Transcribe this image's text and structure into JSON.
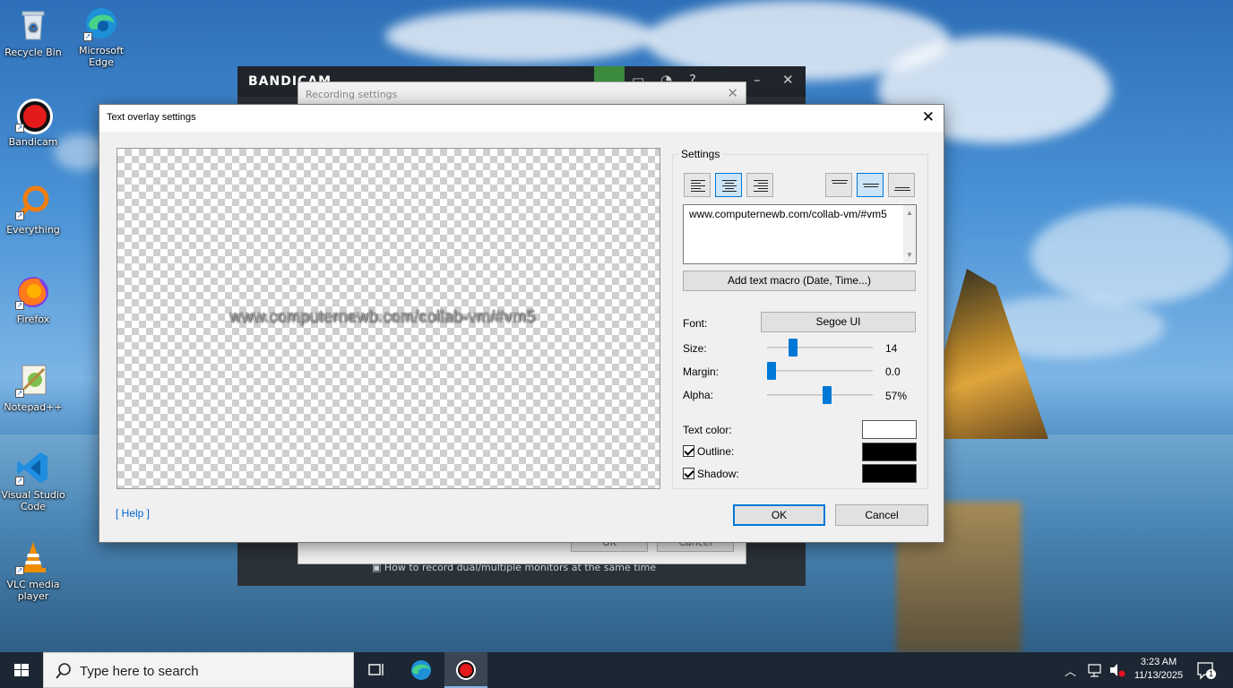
{
  "desktop": {
    "icons": [
      {
        "label": "Recycle Bin"
      },
      {
        "label": "Microsoft Edge"
      },
      {
        "label": "Bandicam"
      },
      {
        "label": "Everything"
      },
      {
        "label": "Firefox"
      },
      {
        "label": "Notepad++"
      },
      {
        "label": "Visual Studio Code"
      },
      {
        "label": "VLC media player"
      }
    ]
  },
  "bandicam_window": {
    "logo": "BANDICAM",
    "footer_tip": "How to record dual/multiple monitors at the same time"
  },
  "recording_settings": {
    "title": "Recording settings",
    "ok_label": "OK",
    "cancel_label": "Cancel"
  },
  "dialog": {
    "title": "Text overlay settings",
    "close_symbol": "✕",
    "preview_text": "www.computernewb.com/collab-vm/#vm5",
    "settings_label": "Settings",
    "text_value": "www.computernewb.com/collab-vm/#vm5",
    "add_macro_label": "Add text macro (Date, Time...)",
    "font_label": "Font:",
    "font_value": "Segoe UI",
    "size_label": "Size:",
    "size_value": "14",
    "margin_label": "Margin:",
    "margin_value": "0.0",
    "alpha_label": "Alpha:",
    "alpha_value": "57%",
    "text_color_label": "Text color:",
    "outline_label": "Outline:",
    "shadow_label": "Shadow:",
    "help_label": "[ Help ]",
    "ok_label": "OK",
    "cancel_label": "Cancel",
    "sliders": {
      "size_fraction": 0.22,
      "margin_fraction": 0.0,
      "alpha_fraction": 0.57
    },
    "alignment": {
      "horizontal_selected": "center",
      "vertical_selected": "middle"
    },
    "colors": {
      "text": "#ffffff",
      "outline": "#000000",
      "shadow": "#000000"
    }
  },
  "taskbar": {
    "search_placeholder": "Type here to search",
    "time": "3:23 AM",
    "date": "11/13/2025",
    "notification_count": "1"
  }
}
